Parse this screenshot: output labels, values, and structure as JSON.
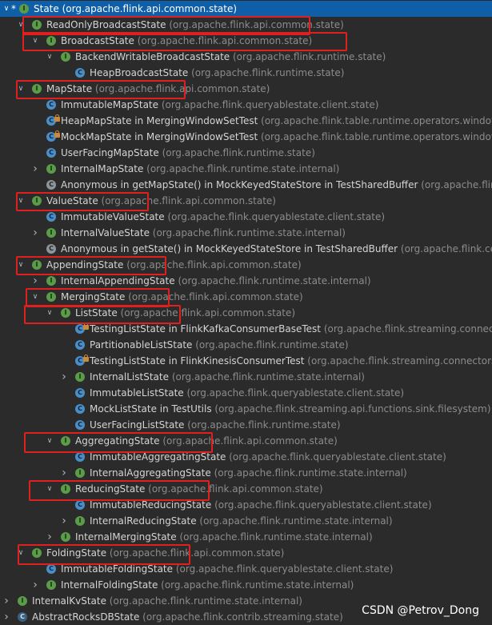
{
  "tree": [
    {
      "name": "State",
      "pkg": "(org.apache.flink.api.common.state)",
      "kind": "interface",
      "depth": 1,
      "arrow": "down",
      "root": true
    },
    {
      "name": "ReadOnlyBroadcastState",
      "pkg": "(org.apache.flink.api.common.state)",
      "kind": "interface",
      "depth": 2,
      "arrow": "down"
    },
    {
      "name": "BroadcastState",
      "pkg": "(org.apache.flink.api.common.state)",
      "kind": "interface",
      "depth": 3,
      "arrow": "down"
    },
    {
      "name": "BackendWritableBroadcastState",
      "pkg": "(org.apache.flink.runtime.state)",
      "kind": "interface",
      "depth": 4,
      "arrow": "down"
    },
    {
      "name": "HeapBroadcastState",
      "pkg": "(org.apache.flink.runtime.state)",
      "kind": "class",
      "depth": 5,
      "arrow": "none"
    },
    {
      "name": "MapState",
      "pkg": "(org.apache.flink.api.common.state)",
      "kind": "interface",
      "depth": 2,
      "arrow": "down"
    },
    {
      "name": "ImmutableMapState",
      "pkg": "(org.apache.flink.queryablestate.client.state)",
      "kind": "class",
      "depth": 3,
      "arrow": "none"
    },
    {
      "name": "HeapMapState in MergingWindowSetTest",
      "pkg": "(org.apache.flink.table.runtime.operators.window",
      "kind": "class",
      "depth": 3,
      "arrow": "none",
      "lock": true
    },
    {
      "name": "MockMapState in MergingWindowSetTest",
      "pkg": "(org.apache.flink.table.runtime.operators.window",
      "kind": "class",
      "depth": 3,
      "arrow": "none",
      "lock": true
    },
    {
      "name": "UserFacingMapState",
      "pkg": "(org.apache.flink.runtime.state)",
      "kind": "class",
      "depth": 3,
      "arrow": "none"
    },
    {
      "name": "InternalMapState",
      "pkg": "(org.apache.flink.runtime.state.internal)",
      "kind": "interface",
      "depth": 3,
      "arrow": "right"
    },
    {
      "name": "Anonymous in getMapState() in MockKeyedStateStore in TestSharedBuffer",
      "pkg": "(org.apache.flink",
      "kind": "anon",
      "depth": 3,
      "arrow": "none"
    },
    {
      "name": "ValueState",
      "pkg": "(org.apache.flink.api.common.state)",
      "kind": "interface",
      "depth": 2,
      "arrow": "down"
    },
    {
      "name": "ImmutableValueState",
      "pkg": "(org.apache.flink.queryablestate.client.state)",
      "kind": "class",
      "depth": 3,
      "arrow": "none"
    },
    {
      "name": "InternalValueState",
      "pkg": "(org.apache.flink.runtime.state.internal)",
      "kind": "interface",
      "depth": 3,
      "arrow": "right"
    },
    {
      "name": "Anonymous in getState() in MockKeyedStateStore in TestSharedBuffer",
      "pkg": "(org.apache.flink.ce",
      "kind": "anon",
      "depth": 3,
      "arrow": "none"
    },
    {
      "name": "AppendingState",
      "pkg": "(org.apache.flink.api.common.state)",
      "kind": "interface",
      "depth": 2,
      "arrow": "down"
    },
    {
      "name": "InternalAppendingState",
      "pkg": "(org.apache.flink.runtime.state.internal)",
      "kind": "interface",
      "depth": 3,
      "arrow": "right"
    },
    {
      "name": "MergingState",
      "pkg": "(org.apache.flink.api.common.state)",
      "kind": "interface",
      "depth": 3,
      "arrow": "down"
    },
    {
      "name": "ListState",
      "pkg": "(org.apache.flink.api.common.state)",
      "kind": "interface",
      "depth": 4,
      "arrow": "down"
    },
    {
      "name": "TestingListState in FlinkKafkaConsumerBaseTest",
      "pkg": "(org.apache.flink.streaming.connect",
      "kind": "class",
      "depth": 5,
      "arrow": "none",
      "lock": true
    },
    {
      "name": "PartitionableListState",
      "pkg": "(org.apache.flink.runtime.state)",
      "kind": "class",
      "depth": 5,
      "arrow": "none"
    },
    {
      "name": "TestingListState in FlinkKinesisConsumerTest",
      "pkg": "(org.apache.flink.streaming.connectors",
      "kind": "class",
      "depth": 5,
      "arrow": "none",
      "lock": true
    },
    {
      "name": "InternalListState",
      "pkg": "(org.apache.flink.runtime.state.internal)",
      "kind": "interface",
      "depth": 5,
      "arrow": "right"
    },
    {
      "name": "ImmutableListState",
      "pkg": "(org.apache.flink.queryablestate.client.state)",
      "kind": "class",
      "depth": 5,
      "arrow": "none"
    },
    {
      "name": "MockListState in TestUtils",
      "pkg": "(org.apache.flink.streaming.api.functions.sink.filesystem)",
      "kind": "class",
      "depth": 5,
      "arrow": "none"
    },
    {
      "name": "UserFacingListState",
      "pkg": "(org.apache.flink.runtime.state)",
      "kind": "class",
      "depth": 5,
      "arrow": "none"
    },
    {
      "name": "AggregatingState",
      "pkg": "(org.apache.flink.api.common.state)",
      "kind": "interface",
      "depth": 4,
      "arrow": "down"
    },
    {
      "name": "ImmutableAggregatingState",
      "pkg": "(org.apache.flink.queryablestate.client.state)",
      "kind": "class",
      "depth": 5,
      "arrow": "none"
    },
    {
      "name": "InternalAggregatingState",
      "pkg": "(org.apache.flink.runtime.state.internal)",
      "kind": "interface",
      "depth": 5,
      "arrow": "right"
    },
    {
      "name": "ReducingState",
      "pkg": "(org.apache.flink.api.common.state)",
      "kind": "interface",
      "depth": 4,
      "arrow": "down"
    },
    {
      "name": "ImmutableReducingState",
      "pkg": "(org.apache.flink.queryablestate.client.state)",
      "kind": "class",
      "depth": 5,
      "arrow": "none"
    },
    {
      "name": "InternalReducingState",
      "pkg": "(org.apache.flink.runtime.state.internal)",
      "kind": "interface",
      "depth": 5,
      "arrow": "right"
    },
    {
      "name": "InternalMergingState",
      "pkg": "(org.apache.flink.runtime.state.internal)",
      "kind": "interface",
      "depth": 4,
      "arrow": "right"
    },
    {
      "name": "FoldingState",
      "pkg": "(org.apache.flink.api.common.state)",
      "kind": "interface",
      "depth": 2,
      "arrow": "down"
    },
    {
      "name": "ImmutableFoldingState",
      "pkg": "(org.apache.flink.queryablestate.client.state)",
      "kind": "class",
      "depth": 3,
      "arrow": "none"
    },
    {
      "name": "InternalFoldingState",
      "pkg": "(org.apache.flink.runtime.state.internal)",
      "kind": "interface",
      "depth": 3,
      "arrow": "right"
    },
    {
      "name": "InternalKvState",
      "pkg": "(org.apache.flink.runtime.state.internal)",
      "kind": "interface",
      "depth": 1,
      "arrow": "right"
    },
    {
      "name": "AbstractRocksDBState",
      "pkg": "(org.apache.flink.contrib.streaming.state)",
      "kind": "abstract",
      "depth": 1,
      "arrow": "right"
    }
  ],
  "icons": {
    "interface": "interface-icon",
    "class": "class-icon",
    "anon": "anonymous-class-icon",
    "abstract": "abstract-class-icon"
  },
  "colors": {
    "background": "#2b2b2b",
    "selection": "#0e5ea8",
    "highlight_box": "#e0201e"
  },
  "watermark": "CSDN @Petrov_Dong"
}
